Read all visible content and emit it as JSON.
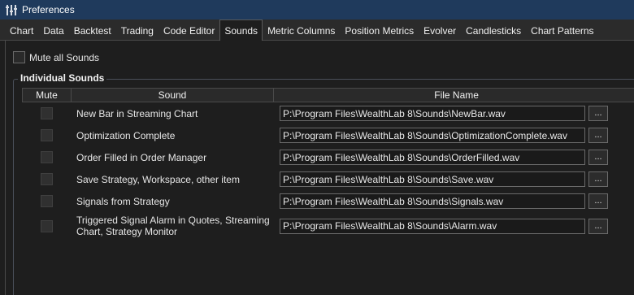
{
  "window": {
    "title": "Preferences",
    "icon": "sliders-icon"
  },
  "tabs": [
    {
      "label": "Chart",
      "active": false
    },
    {
      "label": "Data",
      "active": false
    },
    {
      "label": "Backtest",
      "active": false
    },
    {
      "label": "Trading",
      "active": false
    },
    {
      "label": "Code Editor",
      "active": false
    },
    {
      "label": "Sounds",
      "active": true
    },
    {
      "label": "Metric Columns",
      "active": false
    },
    {
      "label": "Position Metrics",
      "active": false
    },
    {
      "label": "Evolver",
      "active": false
    },
    {
      "label": "Candlesticks",
      "active": false
    },
    {
      "label": "Chart Patterns",
      "active": false
    }
  ],
  "mute_all": {
    "label": "Mute all Sounds",
    "checked": false
  },
  "group": {
    "title": "Individual Sounds",
    "columns": {
      "mute": "Mute",
      "sound": "Sound",
      "file": "File Name"
    },
    "browse_label": "...",
    "rows": [
      {
        "sound": "New Bar in Streaming Chart",
        "file": "P:\\Program Files\\WealthLab 8\\Sounds\\NewBar.wav",
        "muted": false
      },
      {
        "sound": "Optimization Complete",
        "file": "P:\\Program Files\\WealthLab 8\\Sounds\\OptimizationComplete.wav",
        "muted": false
      },
      {
        "sound": "Order Filled in Order Manager",
        "file": "P:\\Program Files\\WealthLab 8\\Sounds\\OrderFilled.wav",
        "muted": false
      },
      {
        "sound": "Save Strategy, Workspace, other item",
        "file": "P:\\Program Files\\WealthLab 8\\Sounds\\Save.wav",
        "muted": false
      },
      {
        "sound": "Signals from Strategy",
        "file": "P:\\Program Files\\WealthLab 8\\Sounds\\Signals.wav",
        "muted": false
      },
      {
        "sound": "Triggered Signal Alarm in Quotes, Streaming Chart, Strategy Monitor",
        "file": "P:\\Program Files\\WealthLab 8\\Sounds\\Alarm.wav",
        "muted": false
      }
    ]
  }
}
